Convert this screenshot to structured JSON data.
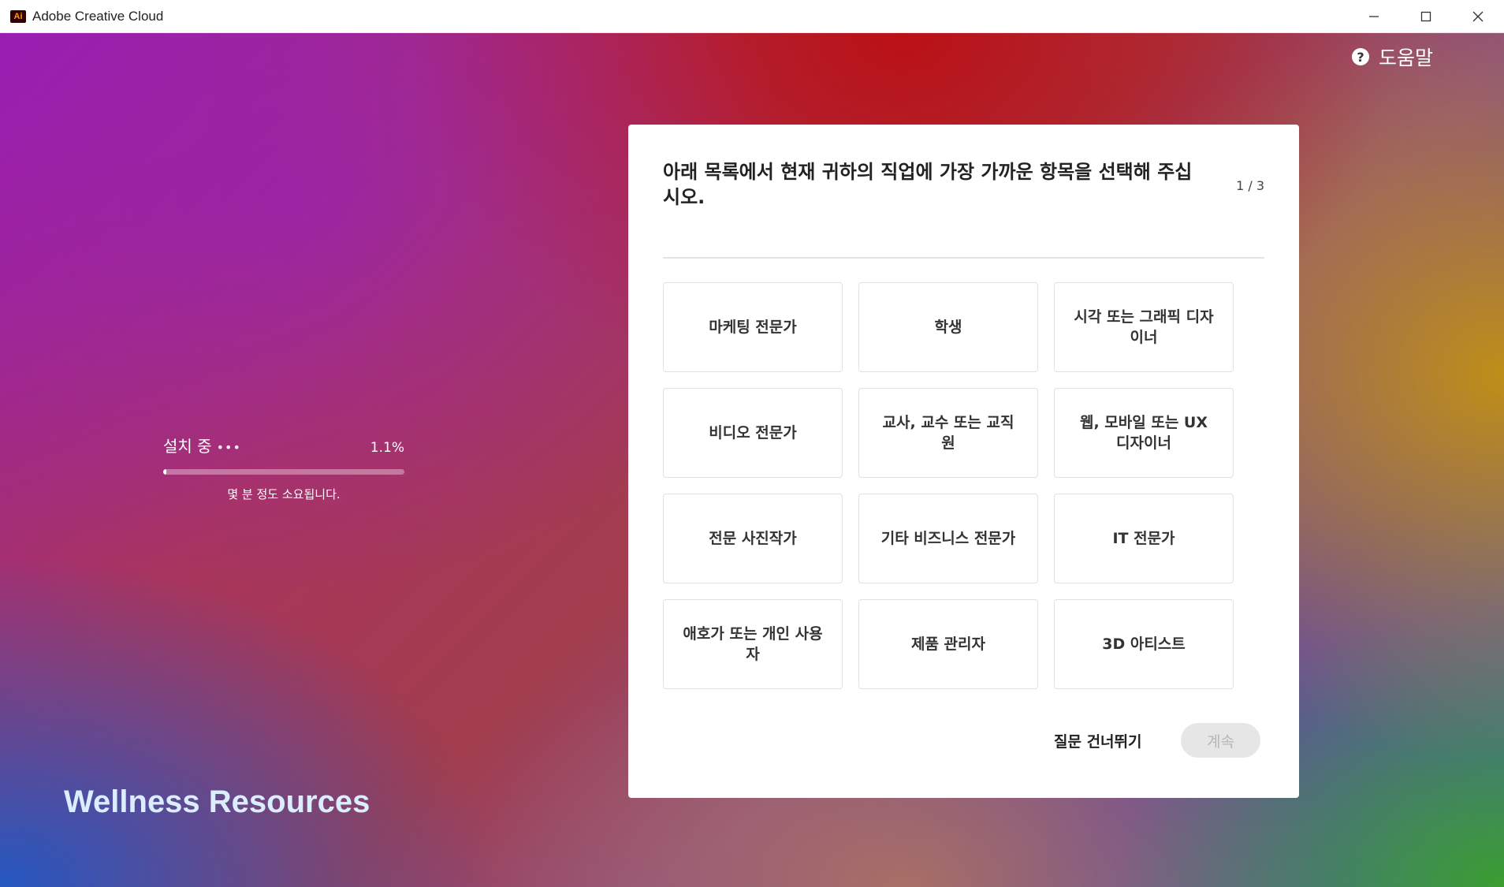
{
  "window": {
    "title": "Adobe Creative Cloud",
    "app_icon_text": "Ai",
    "controls": [
      "minimize-icon",
      "maximize-icon",
      "close-icon"
    ]
  },
  "help": {
    "label": "도움말",
    "icon": "help-circle-icon",
    "icon_text": "?"
  },
  "install": {
    "label": "설치 중",
    "dots": "•••",
    "percent_text": "1.1%",
    "progress": 0.011,
    "subtext": "몇 분 정도 소요됩니다."
  },
  "brand": "Wellness Resources",
  "survey": {
    "question": "아래 목록에서 현재 귀하의 직업에 가장 가까운 항목을 선택해 주십시오.",
    "step": "1 / 3",
    "options": [
      "마케팅 전문가",
      "학생",
      "시각 또는 그래픽 디자이너",
      "비디오 전문가",
      "교사, 교수 또는 교직원",
      "웹, 모바일 또는 UX 디자이너",
      "전문 사진작가",
      "기타 비즈니스 전문가",
      "IT 전문가",
      "애호가 또는 개인 사용자",
      "제품 관리자",
      "3D 아티스트"
    ],
    "skip_label": "질문 건너뛰기",
    "continue_label": "계속"
  },
  "colors": {
    "card": "#ffffff",
    "continue_disabled_bg": "#e6e6e6",
    "continue_disabled_text": "#b6b6b6"
  }
}
